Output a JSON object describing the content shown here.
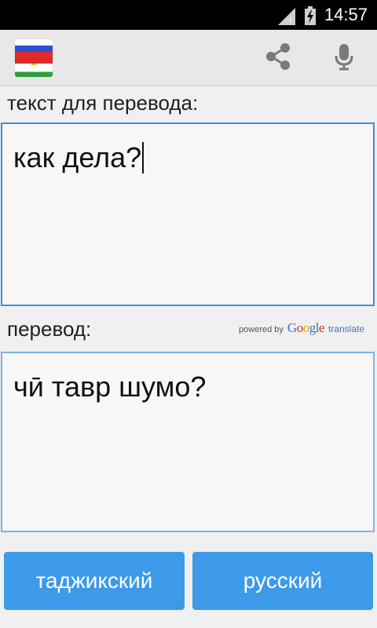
{
  "statusbar": {
    "time": "14:57",
    "signal_icon": "signal-icon",
    "battery_icon": "battery-charging-icon"
  },
  "actionbar": {
    "flag_icon": "russian-tajik-flag-icon",
    "share_icon": "share-icon",
    "mic_icon": "microphone-icon"
  },
  "source": {
    "label": "текст для перевода:",
    "text": "как дела?"
  },
  "target": {
    "label": "перевод:",
    "text": "чӣ тавр шумо?"
  },
  "powered": {
    "prefix": "powered by",
    "google": [
      "G",
      "o",
      "o",
      "g",
      "l",
      "e"
    ],
    "suffix": "translate"
  },
  "buttons": {
    "source_language": "таджикский",
    "target_language": "русский"
  },
  "colors": {
    "accent": "#3d9ae8",
    "focus_border": "#3d8ed8"
  }
}
